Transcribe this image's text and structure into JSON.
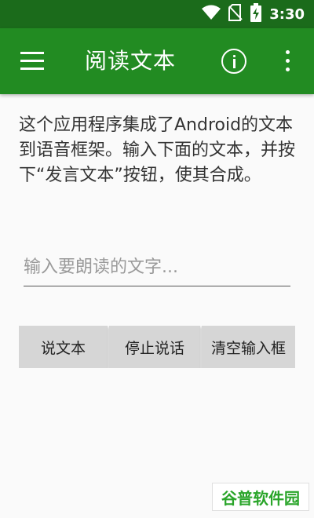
{
  "status_bar": {
    "time": "3:30",
    "icons": [
      "wifi-icon",
      "no-sim-icon",
      "battery-charging-icon"
    ]
  },
  "app_bar": {
    "title": "阅读文本",
    "left_icon": "hamburger-menu-icon",
    "right_icons": [
      "info-icon",
      "more-vert-icon"
    ]
  },
  "main": {
    "description": "这个应用程序集成了Android的文本到语音框架。输入下面的文本，并按下“发言文本”按钮，使其合成。",
    "input": {
      "value": "",
      "placeholder": "输入要朗读的文字..."
    },
    "buttons": [
      {
        "label": "说文本"
      },
      {
        "label": "停止说话"
      },
      {
        "label": "清空输入框"
      }
    ]
  },
  "watermark": {
    "text": "谷普软件园"
  },
  "colors": {
    "status_bar": "#1b6b1b",
    "app_bar": "#228b22",
    "background": "#fafafa",
    "button": "#d6d6d6"
  }
}
